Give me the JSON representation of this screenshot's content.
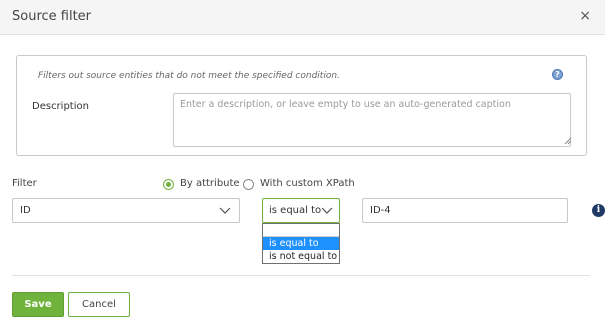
{
  "dialog": {
    "title": "Source filter",
    "close_symbol": "×"
  },
  "description_panel": {
    "hint": "Filters out source entities that do not meet the specified condition.",
    "label": "Description",
    "placeholder": "Enter a description, or leave empty to use an auto-generated caption",
    "value": ""
  },
  "filter": {
    "label": "Filter",
    "mode_options": [
      {
        "label": "By attribute",
        "selected": true
      },
      {
        "label": "With custom XPath",
        "selected": false
      }
    ],
    "attribute": "ID",
    "operator": "is equal to",
    "value": "ID-4",
    "operator_dropdown": {
      "search_value": "",
      "options": [
        {
          "label": "is equal to",
          "highlighted": true
        },
        {
          "label": "is not equal to",
          "highlighted": false
        }
      ]
    }
  },
  "footer": {
    "save_label": "Save",
    "cancel_label": "Cancel"
  },
  "colors": {
    "accent": "#6fb33d",
    "highlight": "#1e90ff",
    "info": "#1f3a66"
  }
}
